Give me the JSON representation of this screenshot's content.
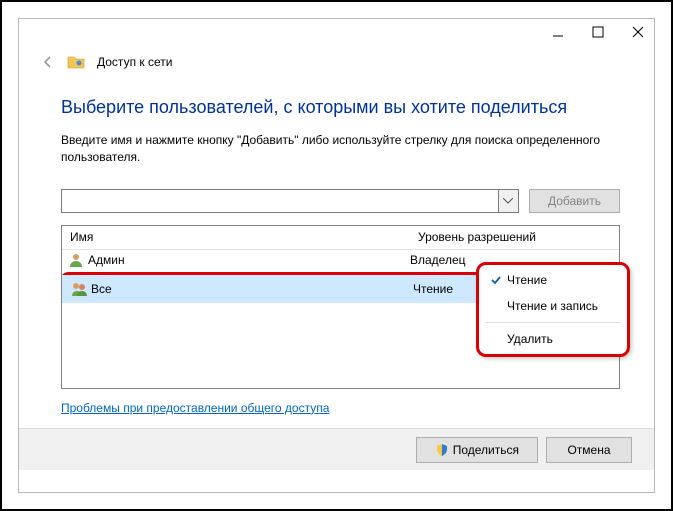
{
  "window": {
    "title": "Доступ к сети"
  },
  "main": {
    "heading": "Выберите пользователей, с которыми вы хотите поделиться",
    "subtext": "Введите имя и нажмите кнопку \"Добавить\" либо используйте стрелку для поиска определенного пользователя.",
    "add_button": "Добавить"
  },
  "table": {
    "col_name": "Имя",
    "col_perm": "Уровень разрешений",
    "rows": [
      {
        "name": "Админ",
        "perm": "Владелец"
      },
      {
        "name": "Все",
        "perm": "Чтение"
      }
    ]
  },
  "link": "Проблемы при предоставлении общего доступа",
  "footer": {
    "share": "Поделиться",
    "cancel": "Отмена"
  },
  "menu": {
    "read": "Чтение",
    "readwrite": "Чтение и запись",
    "remove": "Удалить"
  }
}
